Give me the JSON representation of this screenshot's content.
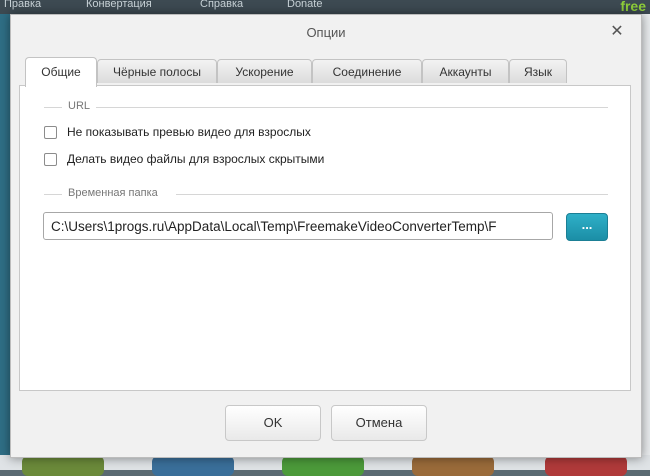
{
  "background_app": {
    "menu": [
      "Правка",
      "Конвертация",
      "Справка",
      "Donate"
    ],
    "logo_text": "free"
  },
  "dialog": {
    "title": "Опции",
    "tabs": [
      {
        "label": "Общие",
        "active": true
      },
      {
        "label": "Чёрные полосы",
        "active": false
      },
      {
        "label": "Ускорение",
        "active": false
      },
      {
        "label": "Соединение",
        "active": false
      },
      {
        "label": "Аккаунты",
        "active": false
      },
      {
        "label": "Язык",
        "active": false
      }
    ],
    "url_group": {
      "label": "URL",
      "options": [
        {
          "label": "Не показывать превью видео для взрослых",
          "checked": false
        },
        {
          "label": "Делать видео файлы для взрослых скрытыми",
          "checked": false
        }
      ]
    },
    "temp_group": {
      "label": "Временная папка",
      "path_value": "C:\\Users\\1progs.ru\\AppData\\Local\\Temp\\FreemakeVideoConverterTemp\\F",
      "browse_label": "..."
    },
    "ok_label": "OK",
    "cancel_label": "Отмена"
  },
  "colors": {
    "accent": "#1b8ea6",
    "dialog_bg": "#f1f1f1"
  },
  "icons": {
    "close": "close-icon"
  }
}
